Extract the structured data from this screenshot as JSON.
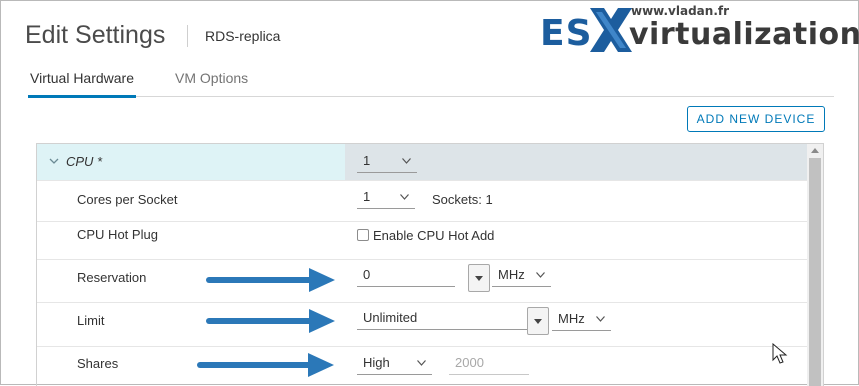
{
  "header": {
    "title": "Edit Settings",
    "subtitle": "RDS-replica"
  },
  "watermark": {
    "url": "www.vladan.fr",
    "brand_es": "ES",
    "brand_rest": "virtualization"
  },
  "tabs": [
    {
      "label": "Virtual Hardware",
      "active": true
    },
    {
      "label": "VM Options",
      "active": false
    }
  ],
  "toolbar": {
    "add_device_label": "ADD NEW DEVICE"
  },
  "cpu": {
    "label": "CPU *",
    "value": "1",
    "info_icon": "info-icon",
    "rows": {
      "cores_per_socket": {
        "label": "Cores per Socket",
        "value": "1",
        "sockets_text": "Sockets: 1"
      },
      "hot_plug": {
        "label": "CPU Hot Plug",
        "checkbox_label": "Enable CPU Hot Add",
        "checked": false
      },
      "reservation": {
        "label": "Reservation",
        "value": "0",
        "unit": "MHz"
      },
      "limit": {
        "label": "Limit",
        "value": "Unlimited",
        "unit": "MHz"
      },
      "shares": {
        "label": "Shares",
        "value": "High",
        "amount": "2000"
      }
    }
  },
  "colors": {
    "accent": "#0079b8",
    "arrow": "#2b78b8",
    "cpu_row_left": "#def3f6",
    "cpu_row_right": "#dde4e8"
  }
}
